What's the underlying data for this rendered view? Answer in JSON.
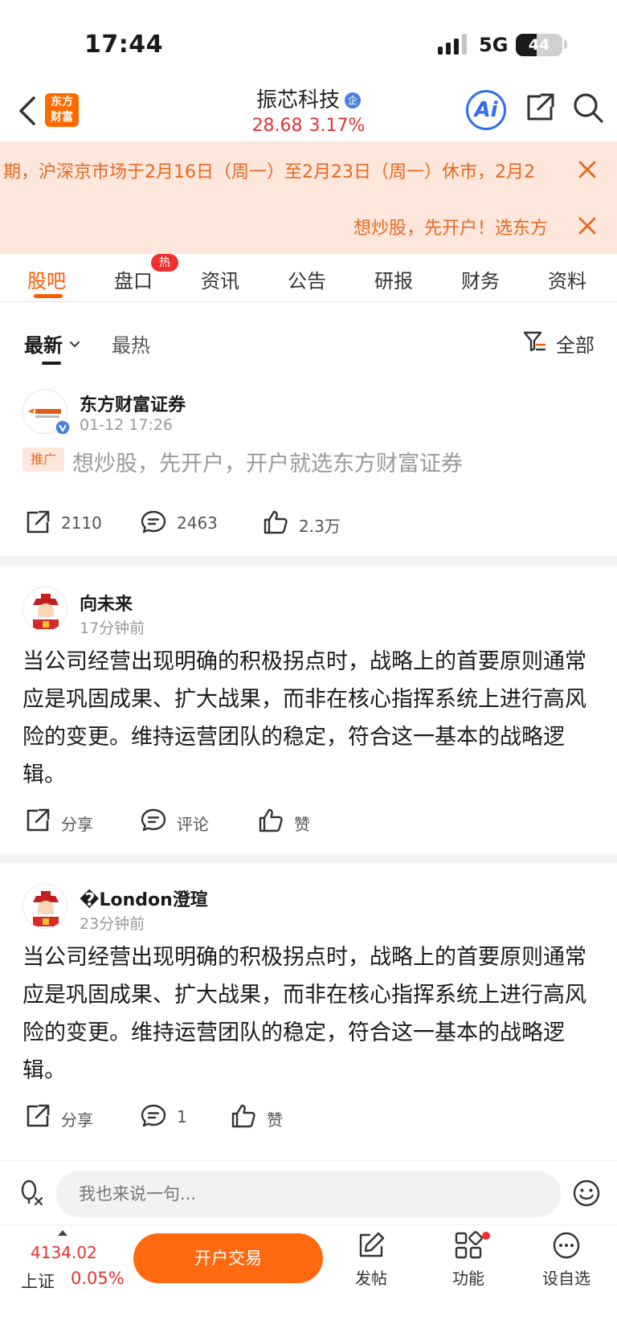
{
  "status_bar": {
    "time": "17:44",
    "network": "5G",
    "battery": "44",
    "battery_level": 0.44
  },
  "header": {
    "logo_line1": "东方",
    "logo_line2": "财富",
    "stock_name": "振芯科技",
    "enterprise_badge": "企",
    "price": "28.68",
    "change_pct": "3.17%",
    "ai_label": "Ai"
  },
  "notices": [
    {
      "text": "期，沪深京市场于2月16日（周一）至2月23日（周一）休市，2月2"
    },
    {
      "text": "想炒股，先开户！选东方"
    }
  ],
  "tabs": [
    {
      "label": "股吧"
    },
    {
      "label": "盘口"
    },
    {
      "label": "资讯"
    },
    {
      "label": "公告"
    },
    {
      "label": "研报"
    },
    {
      "label": "财务"
    },
    {
      "label": "资料"
    }
  ],
  "hot_badge": "热",
  "filters": {
    "latest": "最新",
    "hot": "最热",
    "all": "全部"
  },
  "posts": [
    {
      "author": "东方财富证券",
      "time": "01-12 17:26",
      "promo_tag": "推广",
      "body": "想炒股，先开户，开户就选东方财富证券",
      "share": "2110",
      "comments": "2463",
      "likes": "2.3万"
    },
    {
      "author": "向未来",
      "time": "17分钟前",
      "body": "当公司经营出现明确的积极拐点时，战略上的首要原则通常应是巩固成果、扩大战果，而非在核心指挥系统上进行高风险的变更。维持运营团队的稳定，符合这一基本的战略逻辑。",
      "share": "分享",
      "comments": "评论",
      "likes": "赞"
    },
    {
      "author": "�London澄瑄",
      "time": "23分钟前",
      "body": "当公司经营出现明确的积极拐点时，战略上的首要原则通常应是巩固成果、扩大战果，而非在核心指挥系统上进行高风险的变更。维持运营团队的稳定，符合这一基本的战略逻辑。",
      "share": "分享",
      "comments": "1",
      "likes": "赞"
    }
  ],
  "comment_bar": {
    "placeholder": "我也来说一句..."
  },
  "bottom_bar": {
    "index_value": "4134.02",
    "index_name": "上证",
    "index_change": "0.05%",
    "trade_button": "开户交易",
    "nav": [
      {
        "label": "发帖"
      },
      {
        "label": "功能"
      },
      {
        "label": "设自选"
      }
    ]
  },
  "colors": {
    "accent": "#ff5a00",
    "up": "#e83030",
    "notice_bg": "#fde7dd",
    "notice_text": "#e8681f",
    "ai_blue": "#2f6df2"
  }
}
